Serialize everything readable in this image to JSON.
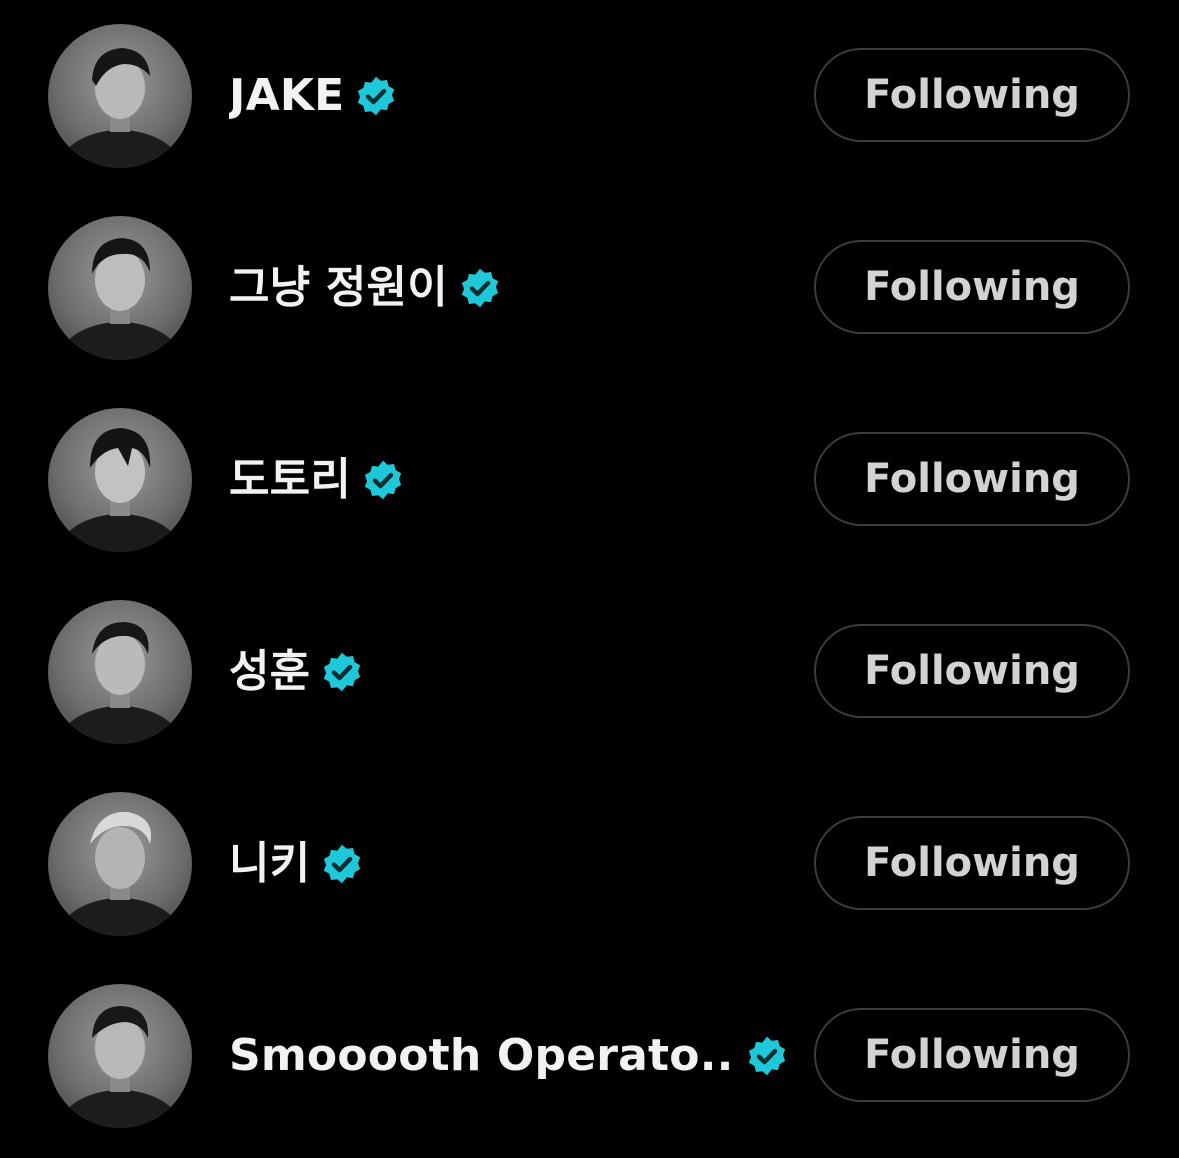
{
  "accent_color": "#1ec8d8",
  "button_border_color": "#3c3c3c",
  "accounts": [
    {
      "name": "JAKE",
      "verified_icon": "verified-badge-icon",
      "button_label": "Following"
    },
    {
      "name": "그냥 정원이",
      "verified_icon": "verified-badge-icon",
      "button_label": "Following"
    },
    {
      "name": "도토리",
      "verified_icon": "verified-badge-icon",
      "button_label": "Following"
    },
    {
      "name": "성훈",
      "verified_icon": "verified-badge-icon",
      "button_label": "Following"
    },
    {
      "name": "니키",
      "verified_icon": "verified-badge-icon",
      "button_label": "Following"
    },
    {
      "name": "Smooooth Operato...",
      "verified_icon": "verified-badge-icon",
      "button_label": "Following"
    }
  ]
}
